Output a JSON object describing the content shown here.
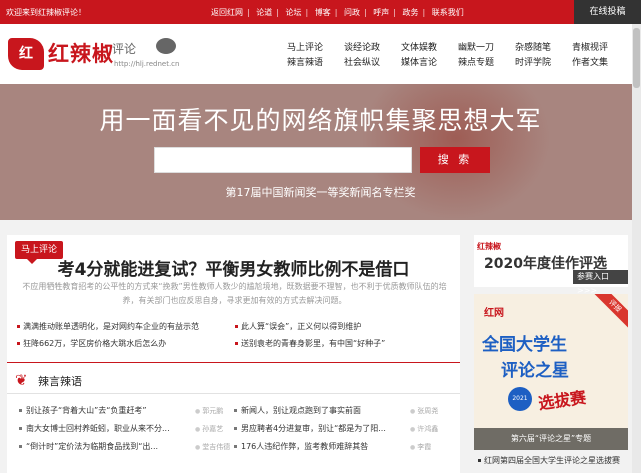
{
  "topbar": {
    "welcome": "欢迎来到红辣椒评论！",
    "links": [
      "返回红网",
      "论道",
      "论坛",
      "博客",
      "问政",
      "呼声",
      "政务",
      "联系我们"
    ],
    "submit": "在线投稿"
  },
  "logo": {
    "mark": "红",
    "title": "红辣椒",
    "subtitle": "评论",
    "url": "http://hlj.rednet.cn"
  },
  "nav": [
    [
      "马上评论",
      "辣言辣语"
    ],
    [
      "谈经论政",
      "社会纵议"
    ],
    [
      "文体娱教",
      "媒体言论"
    ],
    [
      "幽默一刀",
      "辣点专题"
    ],
    [
      "杂感随笔",
      "时评学院"
    ],
    [
      "青椒视评",
      "作者文集"
    ]
  ],
  "banner": {
    "headline": "用一面看不见的网络旗帜集聚思想大军",
    "search_placeholder": "",
    "search_button": "搜 索",
    "award": "第17届中国新闻奖一等奖新闻名专栏奖"
  },
  "main": {
    "tag": "马上评论",
    "headline": "考4分就能进复试？平衡男女教师比例不是借口",
    "summary": "不应用牺牲教育招考的公平性的方式来“挽救”男性教师人数少的尴尬境地，既数据要不理智，也不利于优质教师队伍的培养，有关部门也应反思自身，寻求更加有效的方式去解决问题。",
    "related": [
      "满满推动账单透明化，是对网约车企业的有益示范",
      "此人算“误会”，正义何以得到维护",
      "狂降662万，学区房价格大跳水后怎么办",
      "送别袁老的青春身影里，有中国“好种子”"
    ],
    "section_title": "辣言辣语",
    "items": [
      {
        "title": "别让孩子“背着大山”去“负重赶考”",
        "author": "郭元鹏"
      },
      {
        "title": "新闻人，别让观点跑到了事实前面",
        "author": "张周尧"
      },
      {
        "title": "南大女博士回村养蚯蚓，职业从来不分...",
        "author": "孙嘉艺"
      },
      {
        "title": "男应聘者4分进复审，别让“都是为了阳...",
        "author": "许鸿鑫"
      },
      {
        "title": "“倒计时”定价法为临期食品找到“出...",
        "author": "堂吉伟德"
      },
      {
        "title": "176人违纪作弊，监考教师难辞其咎",
        "author": "李霞"
      }
    ]
  },
  "sidebar": {
    "logo_text": "红辣椒",
    "year_title": "2020年度佳作评选",
    "vote_button": "参赛入口>>>",
    "ad": {
      "logo": "红网",
      "line1": "全国大学生",
      "line2": "评论之星",
      "badge": "2021",
      "line3": "选拔赛",
      "ribbon": "评报",
      "caption": "第六届“评论之星”专题"
    },
    "note": "红网第四届全国大学生评论之星选拔赛"
  }
}
